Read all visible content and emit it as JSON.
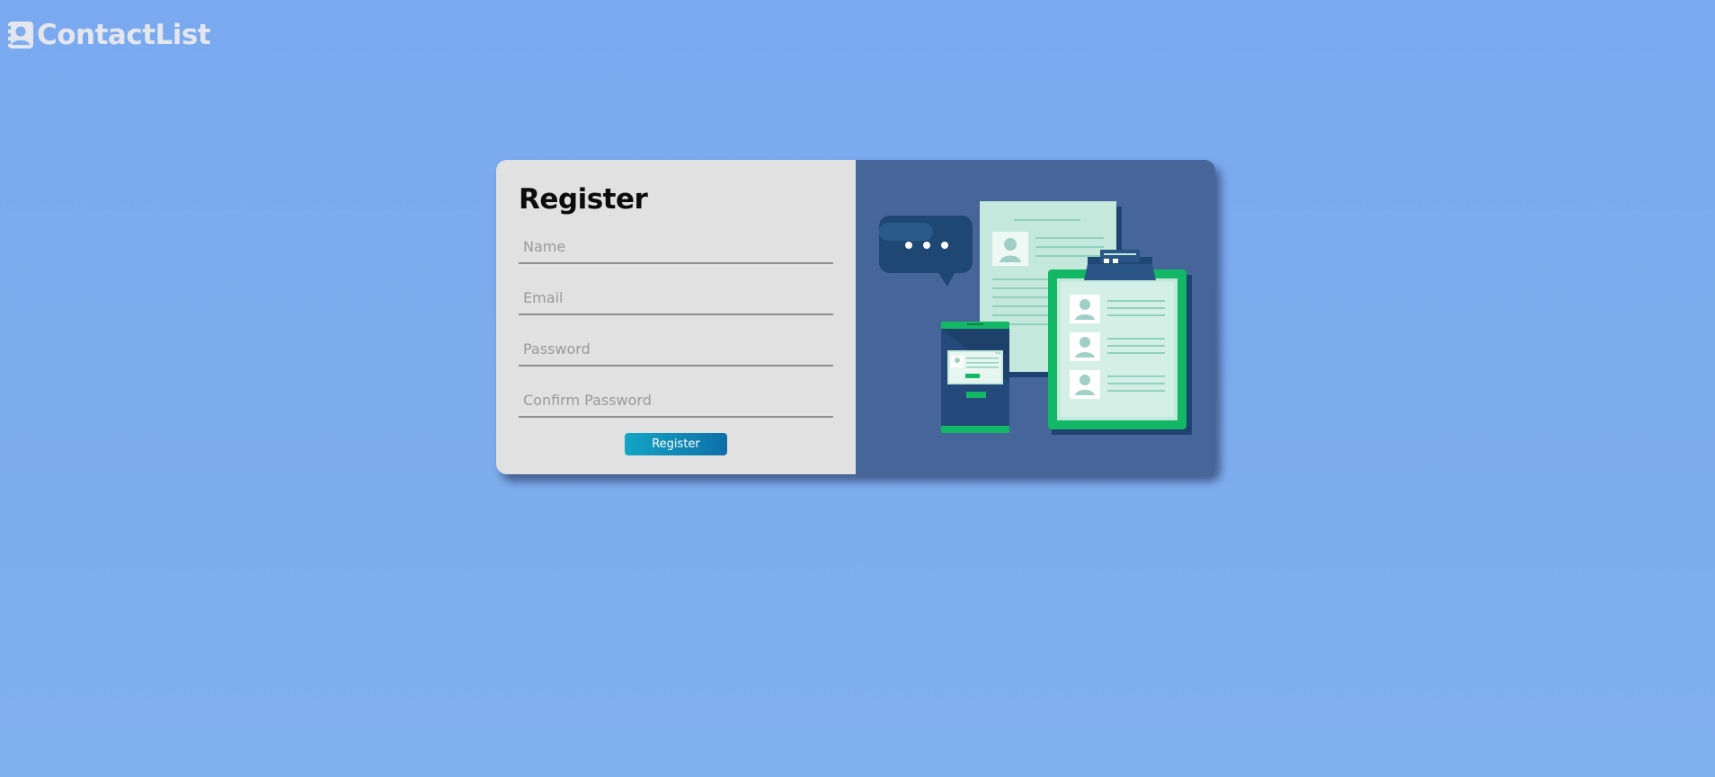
{
  "brand": {
    "name": "ContactList",
    "icon": "contact-book-icon"
  },
  "register_form": {
    "title": "Register",
    "fields": {
      "name": {
        "placeholder": "Name",
        "value": ""
      },
      "email": {
        "placeholder": "Email",
        "value": ""
      },
      "password": {
        "placeholder": "Password",
        "value": ""
      },
      "confirm_password": {
        "placeholder": "Confirm Password",
        "value": ""
      }
    },
    "submit_label": "Register"
  },
  "illustration": {
    "subject": "contacts-illustration",
    "icons": [
      "chat-bubble-icon",
      "resume-document-icon",
      "clipboard-contacts-icon",
      "phone-profile-icon"
    ]
  },
  "colors": {
    "page_background": "#7eacee",
    "card_left": "#e1e1e1",
    "card_right": "#466699",
    "button_start": "#13a5c4",
    "button_end": "#0e6fa8",
    "accent_green": "#10b865"
  }
}
